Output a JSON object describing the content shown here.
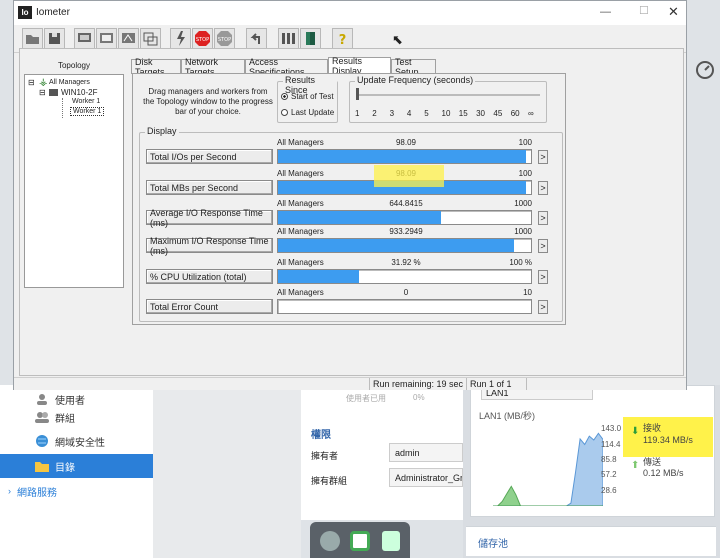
{
  "window": {
    "title": "Iometer"
  },
  "topology": {
    "title": "Topology",
    "root": "All Managers",
    "manager": "WIN10-2F",
    "workers": [
      "Worker 1",
      "Worker 1"
    ]
  },
  "tabs": [
    "Disk Targets",
    "Network Targets",
    "Access Specifications",
    "Results Display",
    "Test Setup"
  ],
  "results": {
    "hint": "Drag managers and workers from the Topology window to the progress bar of your choice.",
    "results_since": {
      "title": "Results Since",
      "options": [
        "Start of Test",
        "Last Update"
      ],
      "selected": 0
    },
    "update_frequency": {
      "title": "Update Frequency (seconds)",
      "ticks": [
        "1",
        "2",
        "3",
        "4",
        "5",
        "10",
        "15",
        "30",
        "45",
        "60",
        "∞"
      ]
    },
    "display_title": "Display",
    "rows": [
      {
        "label": "Total I/Os per Second",
        "target": "All Managers",
        "value": "98.09",
        "max": "100",
        "fraction": 0.9809
      },
      {
        "label": "Total MBs per Second",
        "target": "All Managers",
        "value": "98.09",
        "max": "100",
        "fraction": 0.9809
      },
      {
        "label": "Average I/O Response Time (ms)",
        "target": "All Managers",
        "value": "644.8415",
        "max": "1000",
        "fraction": 0.6448
      },
      {
        "label": "Maximum I/O Response Time (ms)",
        "target": "All Managers",
        "value": "933.2949",
        "max": "1000",
        "fraction": 0.9333
      },
      {
        "label": "% CPU Utilization (total)",
        "target": "All Managers",
        "value": "31.92 %",
        "max": "100 %",
        "fraction": 0.3192
      },
      {
        "label": "Total Error Count",
        "target": "All Managers",
        "value": "0",
        "max": "10",
        "fraction": 0
      }
    ],
    "arrow_label": ">"
  },
  "status": {
    "remaining": "Run remaining: 19 sec",
    "run": "Run 1 of 1"
  },
  "nas": {
    "nav": [
      {
        "label": "使用者",
        "active": false
      },
      {
        "label": "群組",
        "active": false
      },
      {
        "label": "網域安全性",
        "active": false
      },
      {
        "label": "目錄",
        "active": true
      },
      {
        "label": "網路服務",
        "active": false
      }
    ],
    "section_title": "權限",
    "owner_label": "擁有者",
    "owner_value": "admin",
    "group_label": "擁有群組",
    "group_value": "Administrator_Gro",
    "used_label": "使用者已用",
    "used_value": "0%",
    "lan_select": "LAN1",
    "lan_title": "LAN1 (MB/秒)",
    "y_ticks": [
      "143.0",
      "114.4",
      "85.8",
      "57.2",
      "28.6"
    ],
    "recv_label": "接收",
    "recv_value": "119.34 MB/s",
    "send_label": "傳送",
    "send_value": "0.12 MB/s",
    "storage": "儲存池"
  },
  "chart_data": {
    "type": "area",
    "title": "LAN1 (MB/秒)",
    "xlabel": "",
    "ylabel": "",
    "ylim": [
      0,
      143
    ],
    "y_ticks": [
      143.0,
      114.4,
      85.8,
      57.2,
      28.6
    ],
    "series": [
      {
        "name": "接收",
        "values": [
          0,
          0,
          0,
          0,
          0,
          0,
          0,
          0,
          0,
          0,
          0,
          0,
          0,
          0,
          0,
          0,
          0,
          5,
          60,
          120,
          110,
          125,
          118,
          130,
          119
        ]
      },
      {
        "name": "傳送",
        "values": [
          0,
          0,
          8,
          22,
          35,
          20,
          0,
          0,
          0,
          0,
          0,
          0,
          0,
          0,
          0,
          0,
          0,
          0,
          0,
          0,
          0,
          0,
          0,
          0,
          0
        ]
      }
    ]
  }
}
